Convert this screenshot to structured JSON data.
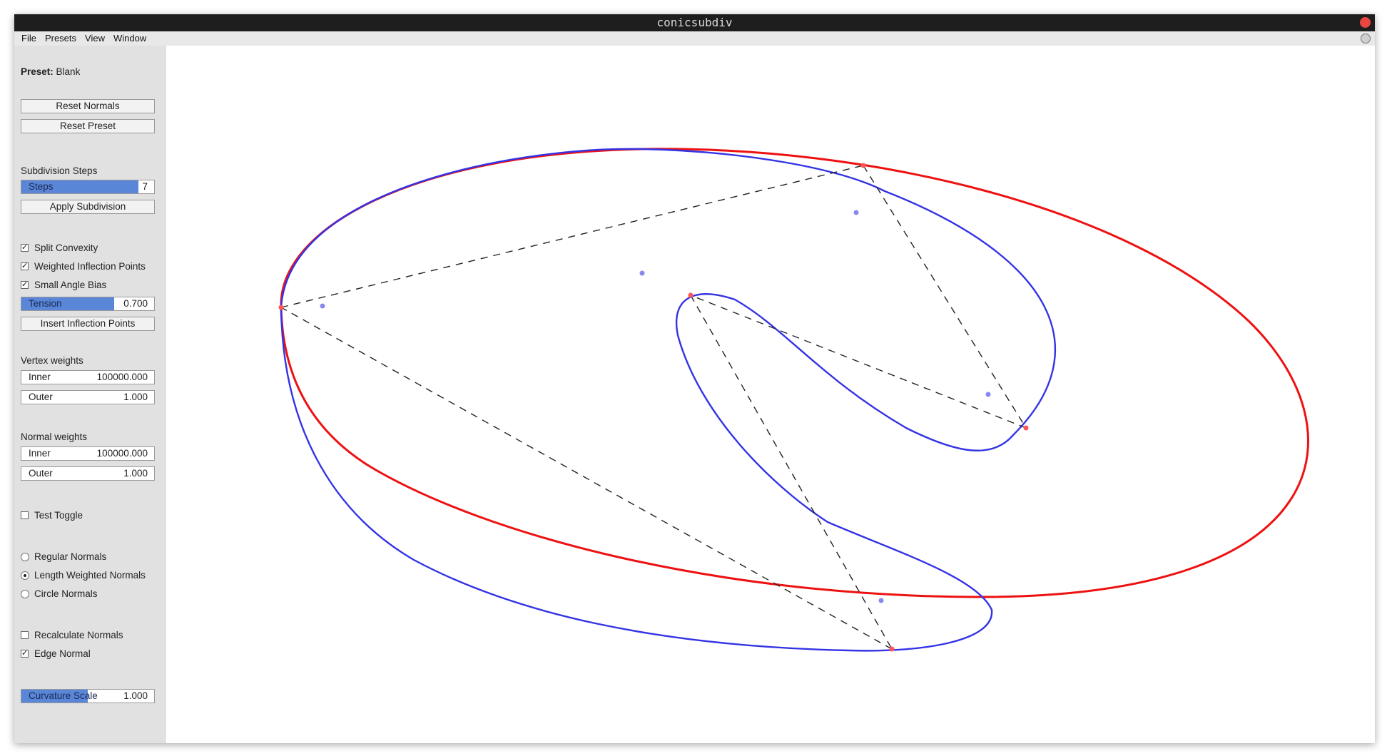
{
  "window": {
    "title": "conicsubdiv",
    "accent_close": "#e8463f"
  },
  "menu": {
    "items": [
      "File",
      "Presets",
      "View",
      "Window"
    ]
  },
  "sidebar": {
    "preset_label": "Preset:",
    "preset_value": "Blank",
    "reset_normals": "Reset Normals",
    "reset_preset": "Reset Preset",
    "subdivision_title": "Subdivision Steps",
    "steps": {
      "label": "Steps",
      "value": "7",
      "fill": 0.88
    },
    "apply_subdivision": "Apply Subdivision",
    "split_convexity": {
      "label": "Split Convexity",
      "checked": true
    },
    "weighted_inflection": {
      "label": "Weighted Inflection Points",
      "checked": true
    },
    "small_angle_bias": {
      "label": "Small Angle Bias",
      "checked": true
    },
    "tension": {
      "label": "Tension",
      "value": "0.700",
      "fill": 0.7
    },
    "insert_inflection": "Insert Inflection Points",
    "vertex_weights_title": "Vertex weights",
    "vertex_inner": {
      "label": "Inner",
      "value": "100000.000"
    },
    "vertex_outer": {
      "label": "Outer",
      "value": "1.000"
    },
    "normal_weights_title": "Normal weights",
    "normal_inner": {
      "label": "Inner",
      "value": "100000.000"
    },
    "normal_outer": {
      "label": "Outer",
      "value": "1.000"
    },
    "test_toggle": {
      "label": "Test Toggle",
      "checked": false
    },
    "normals_mode": {
      "options": [
        "Regular Normals",
        "Length Weighted Normals",
        "Circle Normals"
      ],
      "selected": "Length Weighted Normals"
    },
    "recalculate_normals": {
      "label": "Recalculate Normals",
      "checked": false
    },
    "edge_normal": {
      "label": "Edge Normal",
      "checked": true
    },
    "curvature_scale": {
      "label": "Curvature Scale",
      "value": "1.000",
      "fill": 0.5
    }
  },
  "canvas": {
    "colors": {
      "red_curve": "#ee1111",
      "blue_curve": "#3333e6",
      "control_point": "#ff5555",
      "normal_dot": "#8888ee",
      "dashes": "#222222"
    }
  }
}
